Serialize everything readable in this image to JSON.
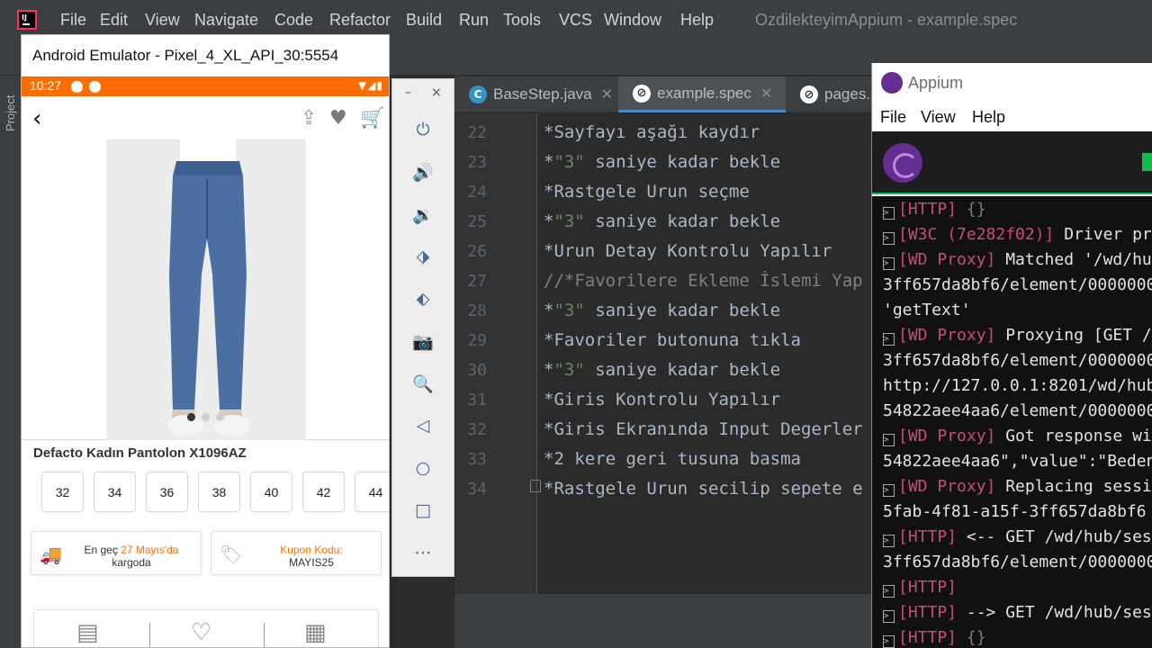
{
  "ide": {
    "menu": [
      "File",
      "Edit",
      "View",
      "Navigate",
      "Code",
      "Refactor",
      "Build",
      "Run",
      "Tools",
      "VCS",
      "Window",
      "Help"
    ],
    "window_title": "OzdilekteyimAppium - example.spec",
    "project_label": "Project",
    "tabs": [
      {
        "label": "BaseStep.java",
        "icon": "java-class-icon",
        "active": false
      },
      {
        "label": "example.spec",
        "icon": "spec-file-icon",
        "active": true
      },
      {
        "label": "pages.",
        "icon": "spec-file-icon",
        "active": false
      }
    ],
    "code_lines": [
      {
        "no": "22",
        "text": "*Sayfayı aşağı kaydır"
      },
      {
        "no": "23",
        "pre": "*",
        "quoted": "\"3\"",
        "post": " saniye kadar bekle"
      },
      {
        "no": "24",
        "text": "*Rastgele Urun seçme"
      },
      {
        "no": "25",
        "pre": "*",
        "quoted": "\"3\"",
        "post": " saniye kadar bekle"
      },
      {
        "no": "26",
        "text": "*Urun Detay Kontrolu Yapılır"
      },
      {
        "no": "27",
        "text": "//*Favorilere Ekleme İslemi Yap",
        "comment": true
      },
      {
        "no": "28",
        "pre": "*",
        "quoted": "\"3\"",
        "post": " saniye kadar bekle"
      },
      {
        "no": "29",
        "text": "*Favoriler butonuna tıkla"
      },
      {
        "no": "30",
        "pre": "*",
        "quoted": "\"3\"",
        "post": " saniye kadar bekle"
      },
      {
        "no": "31",
        "text": "*Giris Kontrolu Yapılır"
      },
      {
        "no": "32",
        "text": "*Giris Ekranında Input Degerler"
      },
      {
        "no": "33",
        "text": "*2 kere geri tusuna basma"
      },
      {
        "no": "34",
        "text": "*Rastgele Urun secilip sepete e"
      }
    ]
  },
  "emulator": {
    "title": "Android Emulator - Pixel_4_XL_API_30:5554",
    "status_time": "10:27",
    "product_name": "Defacto Kadın Pantolon X1096AZ",
    "sizes": [
      "32",
      "34",
      "36",
      "38",
      "40",
      "42",
      "44"
    ],
    "delivery": {
      "prefix": "En geç ",
      "date": "27 Mayıs'da",
      "suffix": "kargoda"
    },
    "coupon": {
      "label": "Kupon Kodu:",
      "code": "MAYIS25"
    },
    "accent_color": "#ff6d00"
  },
  "emulator_controls": {
    "minimize": "–",
    "close": "×",
    "buttons": [
      "power-icon",
      "volume-up-icon",
      "volume-down-icon",
      "rotate-left-icon",
      "rotate-right-icon",
      "camera-icon",
      "zoom-icon",
      "back-triangle-icon",
      "home-circle-icon",
      "overview-square-icon",
      "more-icon"
    ]
  },
  "appium": {
    "title": "Appium",
    "menu": [
      "File",
      "View",
      "Help"
    ],
    "log": [
      {
        "tag": "[HTTP]",
        "text": " ",
        "dim": "{}"
      },
      {
        "tag": "[W3C (7e282f02)]",
        "text": " Driver pr"
      },
      {
        "tag": "[WD Proxy]",
        "text": " Matched '/wd/hu"
      },
      {
        "plain": "3ff657da8bf6/element/0000000"
      },
      {
        "plain": "'getText'"
      },
      {
        "tag": "[WD Proxy]",
        "text": " Proxying [GET /"
      },
      {
        "plain": "3ff657da8bf6/element/0000000"
      },
      {
        "plain": "http://127.0.0.1:8201/wd/hub"
      },
      {
        "plain": "54822aee4aa6/element/0000000"
      },
      {
        "tag": "[WD Proxy]",
        "text": " Got response wi"
      },
      {
        "plain": "54822aee4aa6\",\"value\":\"Beden"
      },
      {
        "tag": "[WD Proxy]",
        "text": " Replacing sessi"
      },
      {
        "plain": "5fab-4f81-a15f-3ff657da8bf6 "
      },
      {
        "tag": "[HTTP]",
        "text": " <-- GET /wd/hub/ses"
      },
      {
        "plain": "3ff657da8bf6/element/0000000"
      },
      {
        "tag": "[HTTP]",
        "text": ""
      },
      {
        "tag": "[HTTP]",
        "text": " --> GET /wd/hub/ses"
      },
      {
        "tag": "[HTTP]",
        "text": " ",
        "dim": "{}"
      }
    ]
  }
}
